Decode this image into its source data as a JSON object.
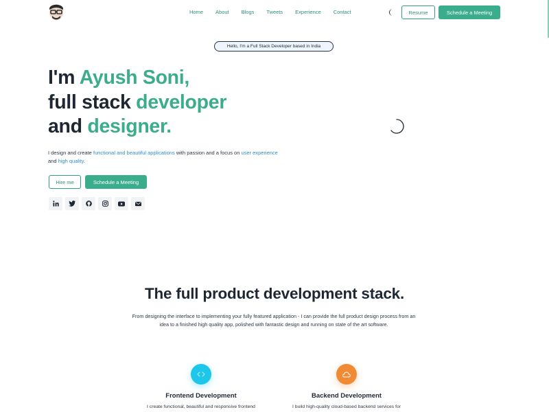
{
  "nav": {
    "links": [
      "Home",
      "About",
      "Blogs",
      "Tweets",
      "Experience",
      "Contact"
    ],
    "resume_label": "Resume",
    "schedule_label": "Schedule a Meeting",
    "theme_icon": "moon-icon",
    "logo_icon": "avatar-logo"
  },
  "hero": {
    "pill": "Hello, I'm a Full Stack Developer based in India",
    "line1_dark": "I'm ",
    "line1_accent": "Ayush Soni,",
    "line2_dark": "full stack ",
    "line2_accent": "developer",
    "line3_dark": "and ",
    "line3_accent": "designer.",
    "desc_1": "I design and create ",
    "desc_link_1": "functional and beautiful applications",
    "desc_2": " with passion and a focus on ",
    "desc_link_2": "user experience",
    "desc_3": " and ",
    "desc_link_3": "high quality",
    "desc_4": ".",
    "hire_label": "Hire me",
    "schedule_label": "Schedule a Meeting",
    "socials": [
      "linkedin-icon",
      "twitter-icon",
      "github-icon",
      "instagram-icon",
      "youtube-icon",
      "mail-icon"
    ]
  },
  "stack": {
    "title": "The full product development stack.",
    "desc": "From designing the interface to implementing your fully featured application - I can provide the full product design process from an idea to a finished high quality app, polished with fantastic design and running on state of the art software.",
    "cards": [
      {
        "icon": "code-icon",
        "title": "Frontend Development",
        "text": "I create functional, beautiful and responsive frontend"
      },
      {
        "icon": "cloud-icon",
        "title": "Backend Development",
        "text": "I build high-quality cloud-based backend services for"
      }
    ]
  },
  "colors": {
    "accent": "#3bad8c",
    "link": "#2d8ecf",
    "text": "#1f2733",
    "frontend_icon_bg": "#1cc7ea",
    "backend_icon_bg": "#f08a35"
  }
}
